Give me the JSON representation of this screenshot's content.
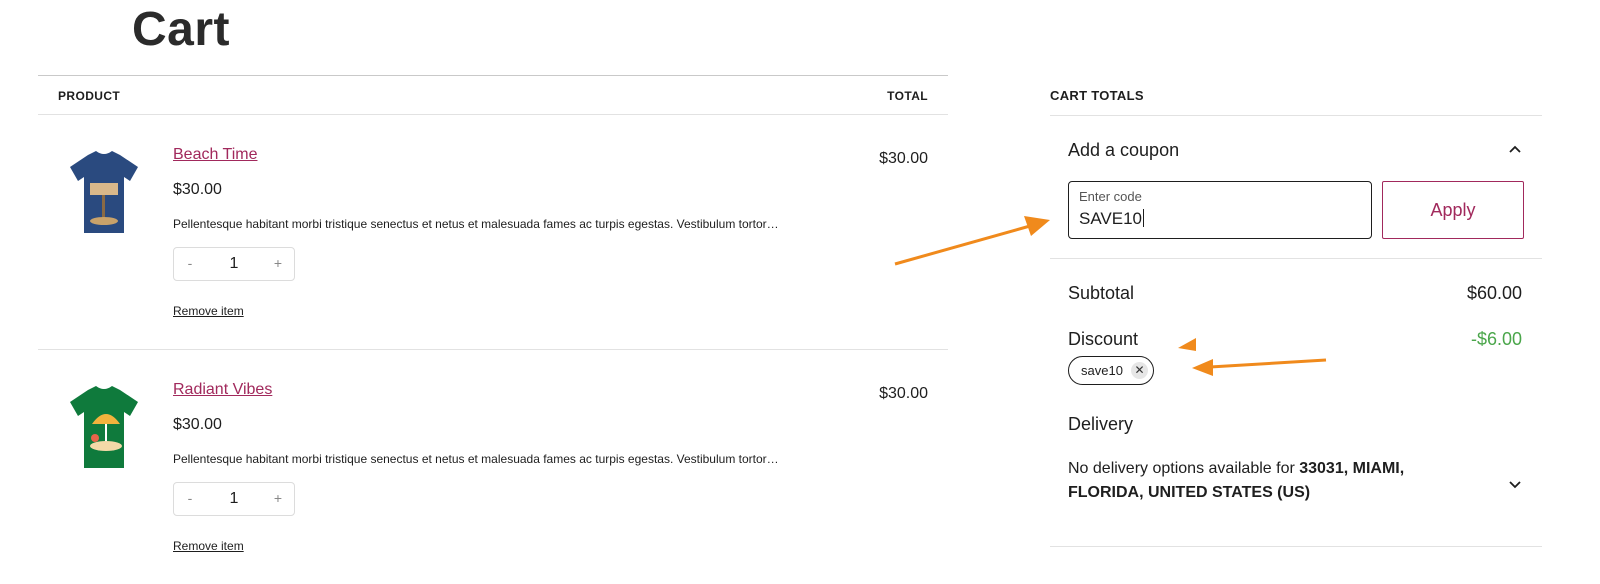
{
  "page": {
    "title": "Cart"
  },
  "table": {
    "col_product": "PRODUCT",
    "col_total": "TOTAL",
    "items": [
      {
        "name": "Beach Time",
        "price": "$30.00",
        "description": "Pellentesque habitant morbi tristique senectus et netus et malesuada fames ac turpis egestas. Vestibulum tortor…",
        "quantity": "1",
        "minus": "-",
        "plus": "+",
        "remove": "Remove item",
        "line_total": "$30.00",
        "shirt_color": "#2a4a7f"
      },
      {
        "name": "Radiant Vibes",
        "price": "$30.00",
        "description": "Pellentesque habitant morbi tristique senectus et netus et malesuada fames ac turpis egestas. Vestibulum tortor…",
        "quantity": "1",
        "minus": "-",
        "plus": "+",
        "remove": "Remove item",
        "line_total": "$30.00",
        "shirt_color": "#0f7a3c"
      }
    ]
  },
  "totals": {
    "title": "CART TOTALS",
    "coupon": {
      "label": "Add a coupon",
      "field_label": "Enter code",
      "field_value": "SAVE10",
      "apply": "Apply"
    },
    "subtotal_label": "Subtotal",
    "subtotal_value": "$60.00",
    "discount_label": "Discount",
    "discount_value": "-$6.00",
    "applied_coupon": "save10",
    "remove_coupon": "✕",
    "delivery_label": "Delivery",
    "delivery_text_prefix": "No delivery options available for ",
    "delivery_location": "33031, MIAMI, FLORIDA, UNITED STATES (US)"
  },
  "colors": {
    "accent": "#a1295c",
    "discount": "#4aa64a",
    "annotation_arrow": "#f08a1c"
  },
  "icons": {
    "coupon_toggle": "chevron-up-icon",
    "delivery_toggle": "chevron-down-icon",
    "remove_coupon": "close-icon"
  }
}
